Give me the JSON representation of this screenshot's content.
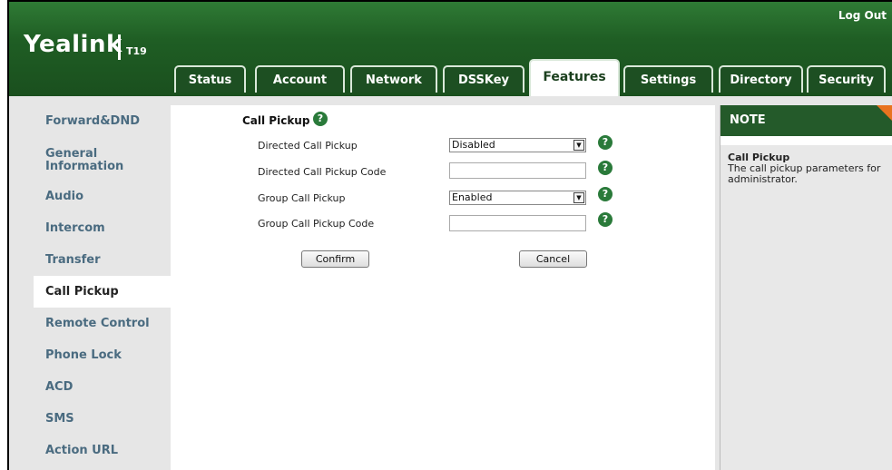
{
  "header": {
    "logout": "Log Out",
    "logo": "Yealink",
    "model": "T19"
  },
  "tabs": [
    {
      "label": "Status"
    },
    {
      "label": "Account"
    },
    {
      "label": "Network"
    },
    {
      "label": "DSSKey"
    },
    {
      "label": "Features"
    },
    {
      "label": "Settings"
    },
    {
      "label": "Directory"
    },
    {
      "label": "Security"
    }
  ],
  "sidebar": {
    "items": [
      {
        "label": "Forward&DND"
      },
      {
        "label": "General Information"
      },
      {
        "label": "Audio"
      },
      {
        "label": "Intercom"
      },
      {
        "label": "Transfer"
      },
      {
        "label": "Call Pickup"
      },
      {
        "label": "Remote Control"
      },
      {
        "label": "Phone Lock"
      },
      {
        "label": "ACD"
      },
      {
        "label": "SMS"
      },
      {
        "label": "Action URL"
      }
    ]
  },
  "main": {
    "title": "Call Pickup",
    "fields": {
      "directed_pickup": {
        "label": "Directed Call Pickup",
        "value": "Disabled"
      },
      "directed_code": {
        "label": "Directed Call Pickup Code",
        "value": ""
      },
      "group_pickup": {
        "label": "Group Call Pickup",
        "value": "Enabled"
      },
      "group_code": {
        "label": "Group Call Pickup Code",
        "value": ""
      }
    },
    "confirm": "Confirm",
    "cancel": "Cancel"
  },
  "note": {
    "header": "NOTE",
    "title": "Call Pickup",
    "text": "The call pickup parameters for administrator."
  },
  "colors": {
    "header_green": "#1f5e24",
    "link_blue": "#4a6b80",
    "help_green": "#2a7a3a",
    "note_corner": "#e8731f"
  },
  "icons": {
    "help": "question-circle-icon",
    "dropdown": "chevron-down-icon"
  }
}
